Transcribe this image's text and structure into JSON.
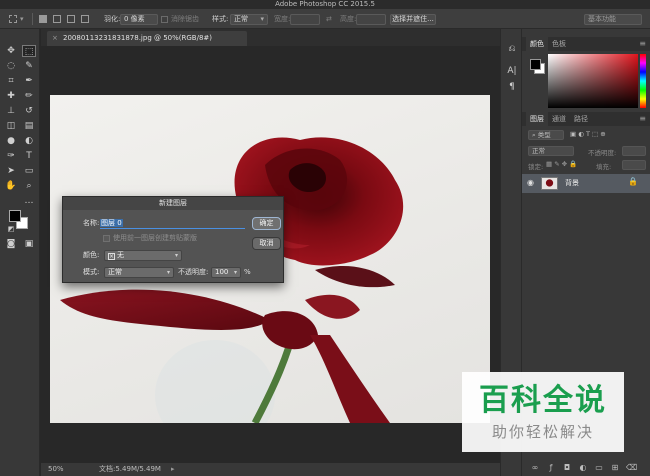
{
  "app": {
    "title": "Adobe Photoshop CC 2015.5"
  },
  "options_bar": {
    "feather_label": "羽化:",
    "feather_value": "0 像素",
    "antialias_label": "消除锯齿",
    "style_label": "样式:",
    "style_value": "正常",
    "width_label": "宽度:",
    "height_label": "高度:",
    "select_mask_button": "选择并遮住...",
    "workspace": "基本功能"
  },
  "document": {
    "tab_label": "20080113231831878.jpg @ 50%(RGB/8#)",
    "close": "×"
  },
  "status": {
    "zoom": "50%",
    "doc_info": "文档:5.49M/5.49M",
    "arrow": "▸"
  },
  "right_panel": {
    "color_tabs": [
      "颜色",
      "色板"
    ],
    "layers_tabs": [
      "图层",
      "通道",
      "路径"
    ],
    "filter_kind": "类型",
    "blend_mode": "正常",
    "opacity_label": "不透明度:",
    "lock_label": "锁定:",
    "fill_label": "填充:",
    "layer_name": "背景"
  },
  "dialog": {
    "title": "新建图层",
    "name_label": "名称:",
    "name_value": "图层 0",
    "checkbox_label": "使用前一图层创建剪贴蒙版",
    "color_label": "颜色:",
    "color_value": "无",
    "mode_label": "模式:",
    "mode_value": "正常",
    "opacity_label": "不透明度:",
    "opacity_value": "100",
    "opacity_unit": "%",
    "ok_button": "确定",
    "cancel_button": "取消"
  },
  "watermark": {
    "main": "百科全说",
    "sub": "助你轻松解决"
  }
}
